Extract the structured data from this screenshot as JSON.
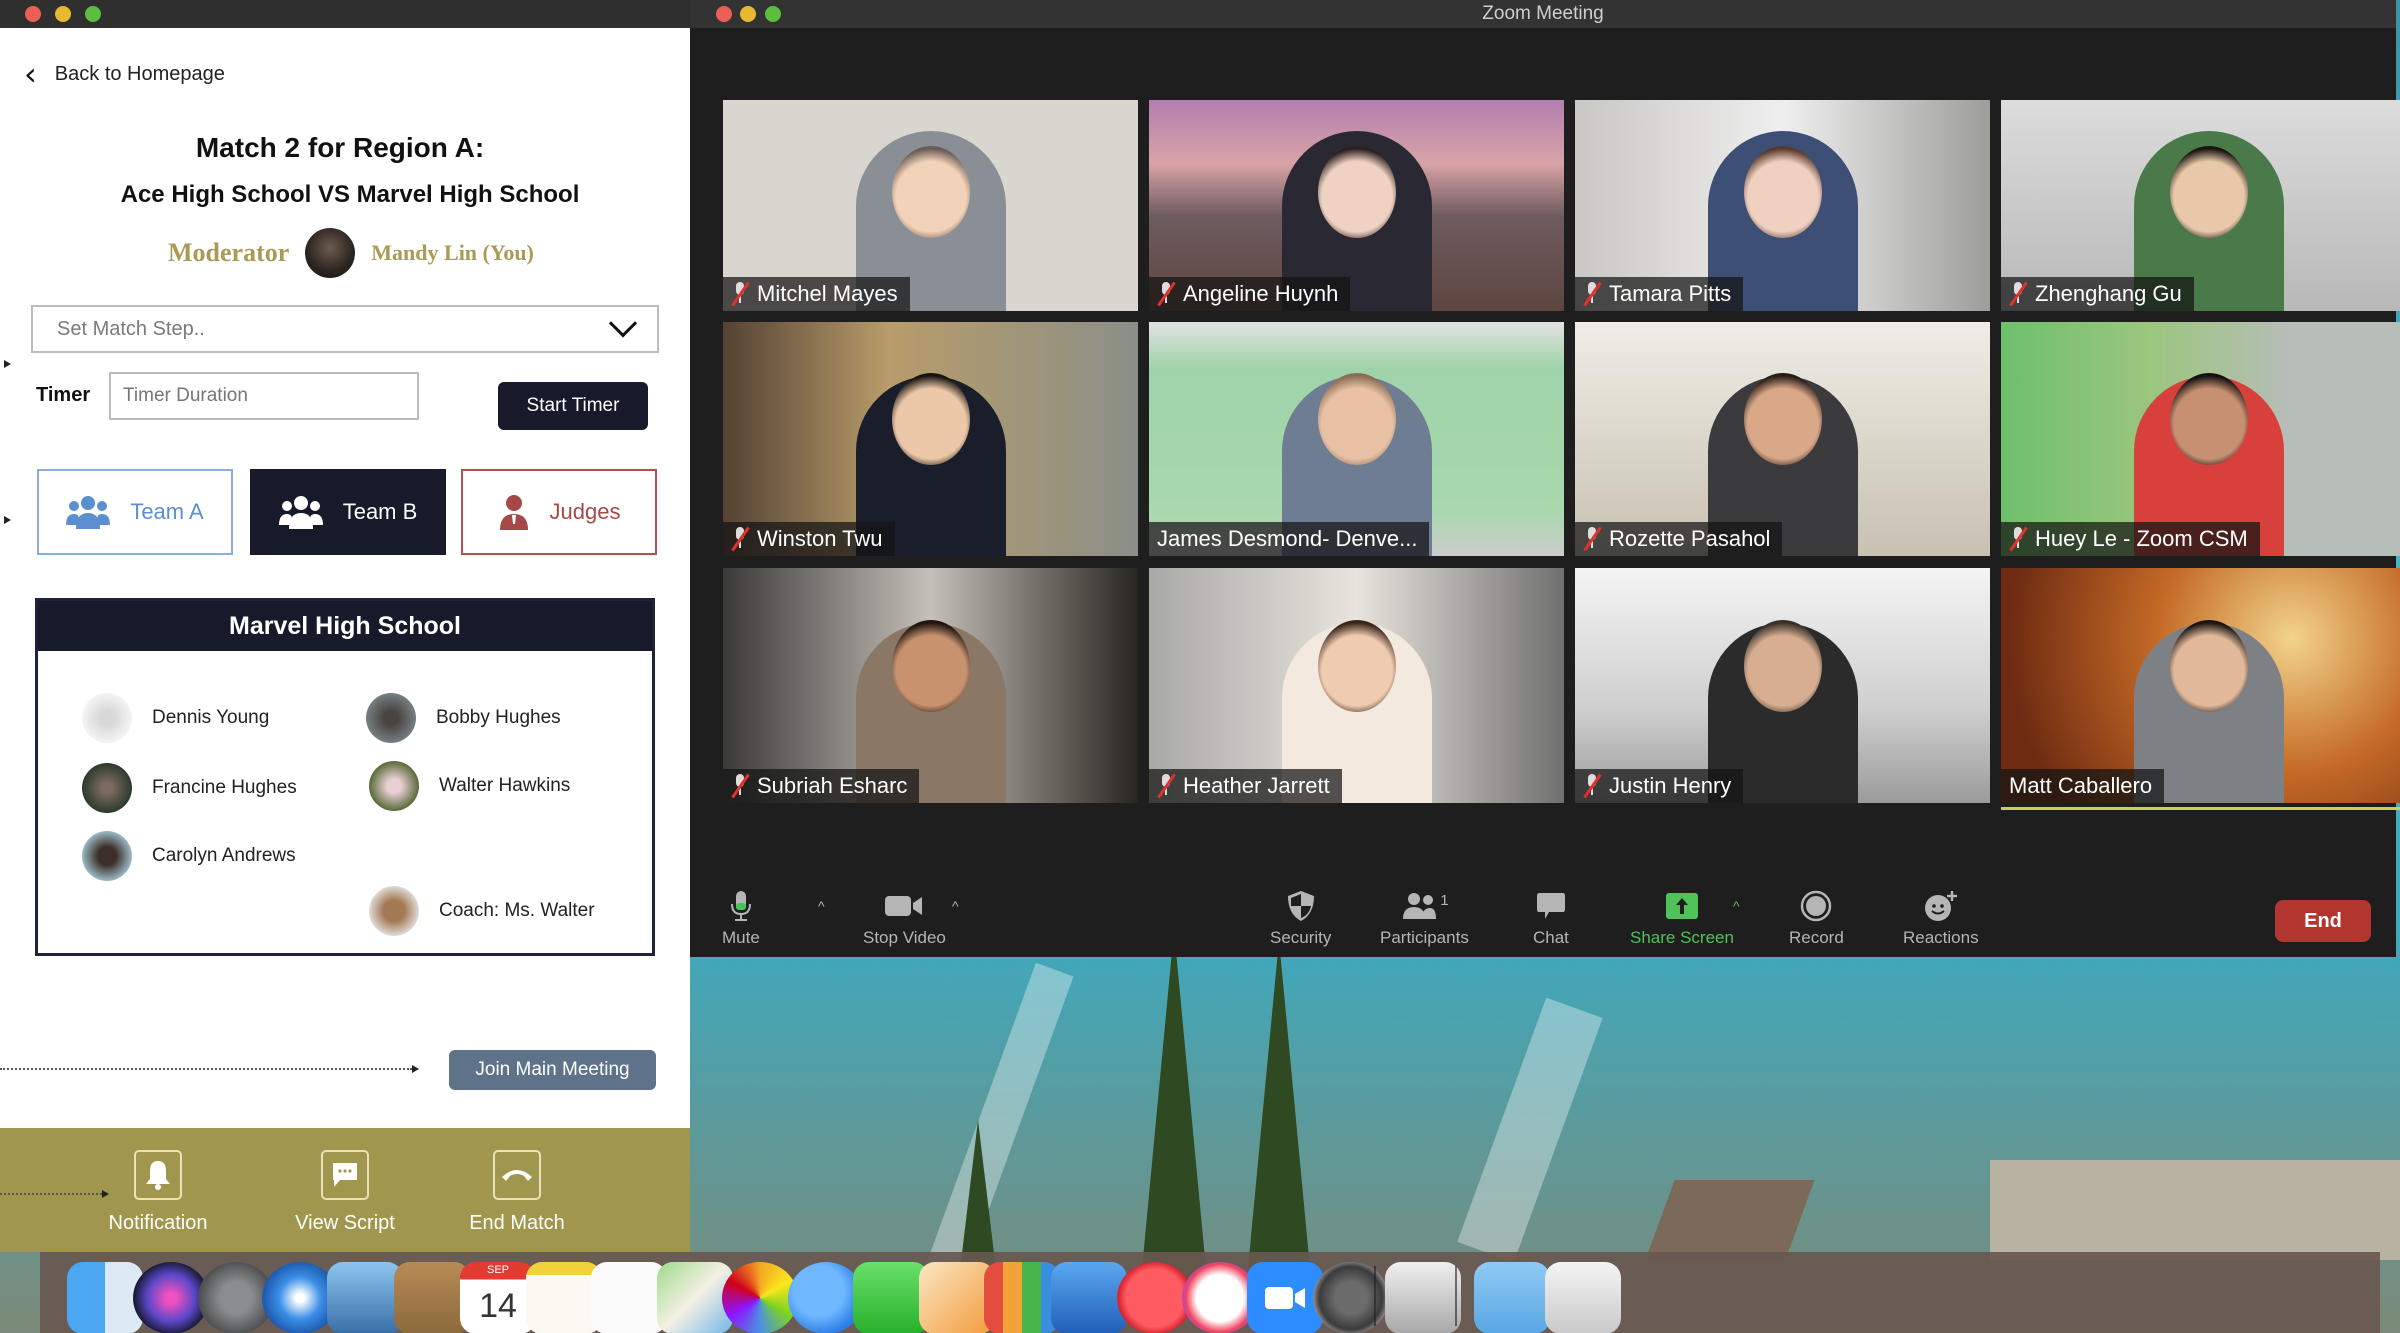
{
  "left_app": {
    "back_label": "Back to Homepage",
    "match_title": "Match 2 for Region A:",
    "match_subtitle": "Ace High School VS Marvel High School",
    "moderator_role": "Moderator",
    "moderator_name": "Mandy Lin (You)",
    "match_step_placeholder": "Set Match Step..",
    "timer_label": "Timer",
    "timer_placeholder": "Timer Duration",
    "start_timer_label": "Start Timer",
    "tabs": [
      {
        "label": "Team A",
        "icon": "team-icon",
        "state": "outline",
        "color": "#5b8fd0"
      },
      {
        "label": "Team B",
        "icon": "team-icon",
        "state": "selected",
        "color": "#161a2b"
      },
      {
        "label": "Judges",
        "icon": "judge-icon",
        "state": "outline",
        "color": "#a54848"
      }
    ],
    "roster": {
      "title": "Marvel High School",
      "members": [
        {
          "name": "Dennis Young"
        },
        {
          "name": "Bobby Hughes"
        },
        {
          "name": "Francine Hughes"
        },
        {
          "name": "Walter Hawkins"
        },
        {
          "name": "Carolyn Andrews"
        },
        {
          "name": "Coach: Ms. Walter"
        }
      ]
    },
    "join_main_label": "Join Main Meeting",
    "actions": [
      {
        "label": "Notification",
        "icon": "bell-icon"
      },
      {
        "label": "View Script",
        "icon": "chat-bubble-icon"
      },
      {
        "label": "End Match",
        "icon": "hang-up-icon"
      }
    ],
    "colors": {
      "navy": "#161a2b",
      "gold": "#a0964e",
      "gold_text": "#a99a55",
      "join": "#5e728a"
    }
  },
  "zoom": {
    "window_title": "Zoom Meeting",
    "participants": [
      {
        "name": "Mitchel Mayes",
        "muted": true
      },
      {
        "name": "Angeline Huynh",
        "muted": true
      },
      {
        "name": "Tamara Pitts",
        "muted": true
      },
      {
        "name": "Zhenghang Gu",
        "muted": true
      },
      {
        "name": "Winston Twu",
        "muted": true
      },
      {
        "name": "James Desmond- Denve...",
        "muted": false
      },
      {
        "name": "Rozette Pasahol",
        "muted": true
      },
      {
        "name": "Huey Le - Zoom CSM",
        "muted": true
      },
      {
        "name": "Subriah Esharc",
        "muted": true
      },
      {
        "name": "Heather Jarrett",
        "muted": true
      },
      {
        "name": "Justin Henry",
        "muted": true
      },
      {
        "name": "Matt Caballero",
        "muted": false,
        "active_speaker": true
      }
    ],
    "toolbar": {
      "mute": "Mute",
      "stop_video": "Stop Video",
      "security": "Security",
      "participants": "Participants",
      "participants_count": "1",
      "chat": "Chat",
      "share_screen": "Share Screen",
      "record": "Record",
      "reactions": "Reactions",
      "end": "End"
    },
    "colors": {
      "share_green": "#4fc25a",
      "end_red": "#b2362f"
    }
  },
  "dock": {
    "apps": [
      "Finder",
      "Siri",
      "Launchpad",
      "Safari",
      "Mail",
      "Contacts",
      "Calendar",
      "Notes",
      "Reminders",
      "Maps",
      "Photos",
      "Messages",
      "FaceTime",
      "Pages",
      "Numbers",
      "Keynote",
      "News",
      "Music",
      "Zoom",
      "System Preferences",
      "Boot Camp",
      "Downloads",
      "Trash"
    ],
    "calendar_month": "SEP",
    "calendar_day": "14"
  }
}
